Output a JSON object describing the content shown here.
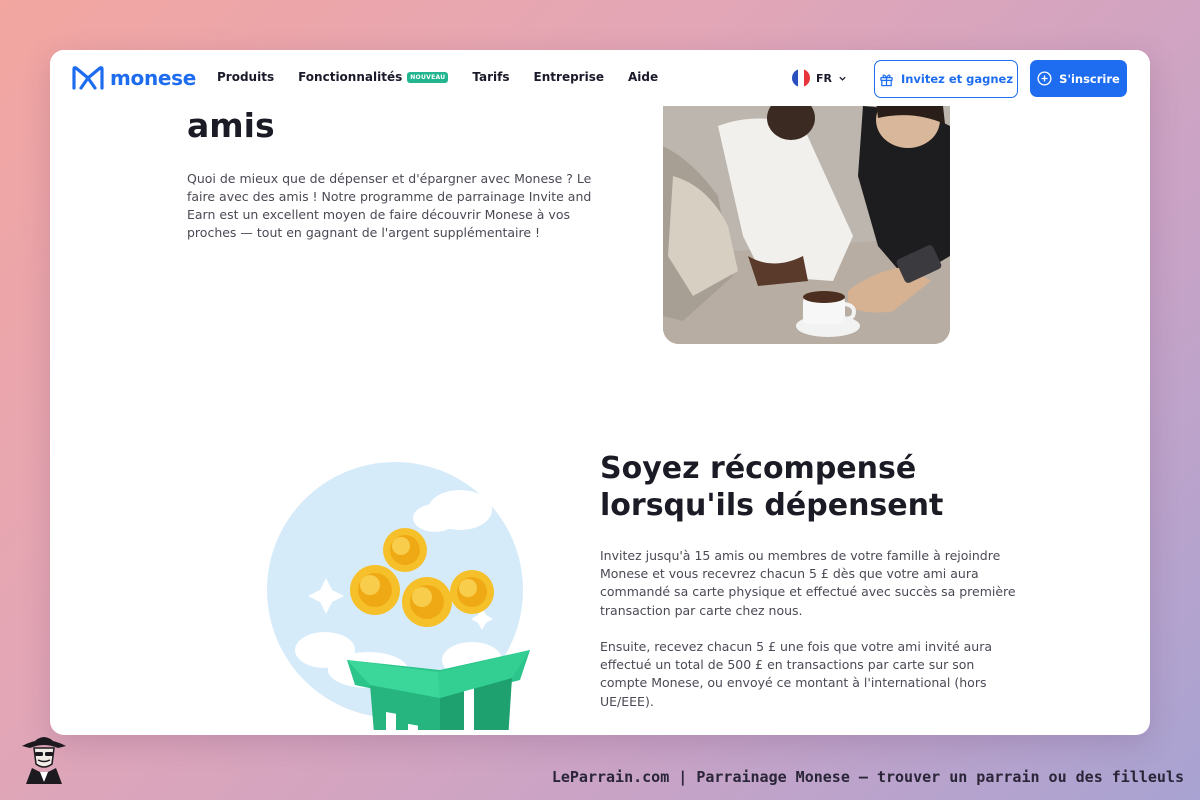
{
  "brand": {
    "name": "monese",
    "color": "#1e6df0"
  },
  "nav": {
    "items": [
      {
        "label": "Produits"
      },
      {
        "label": "Fonctionnalités",
        "badge": "NOUVEAU"
      },
      {
        "label": "Tarifs"
      },
      {
        "label": "Entreprise"
      },
      {
        "label": "Aide"
      }
    ],
    "language": "FR",
    "invite_label": "Invitez et gagnez",
    "signup_label": "S'inscrire"
  },
  "section1": {
    "heading": "amis",
    "paragraph": "Quoi de mieux que de dépenser et d'épargner avec Monese ? Le faire avec des amis ! Notre programme de parrainage Invite and Earn est un excellent moyen de faire découvrir Monese à vos proches — tout en gagnant de l'argent supplémentaire !"
  },
  "section2": {
    "heading_line1": "Soyez récompensé",
    "heading_line2": "lorsqu'ils dépensent",
    "paragraph1": "Invitez jusqu'à 15 amis ou membres de votre famille à rejoindre Monese et vous recevrez chacun 5 £ dès que votre ami aura commandé sa carte physique et effectué avec succès sa première transaction par carte chez nous.",
    "paragraph2": "Ensuite, recevez chacun 5 £ une fois que votre ami invité aura effectué un total de 500 £ en transactions par carte sur son compte Monese, ou envoyé ce montant à l'international (hors UE/EEE)."
  },
  "footer": {
    "caption": "LeParrain.com | Parrainage Monese — trouver un parrain ou des filleuls"
  }
}
